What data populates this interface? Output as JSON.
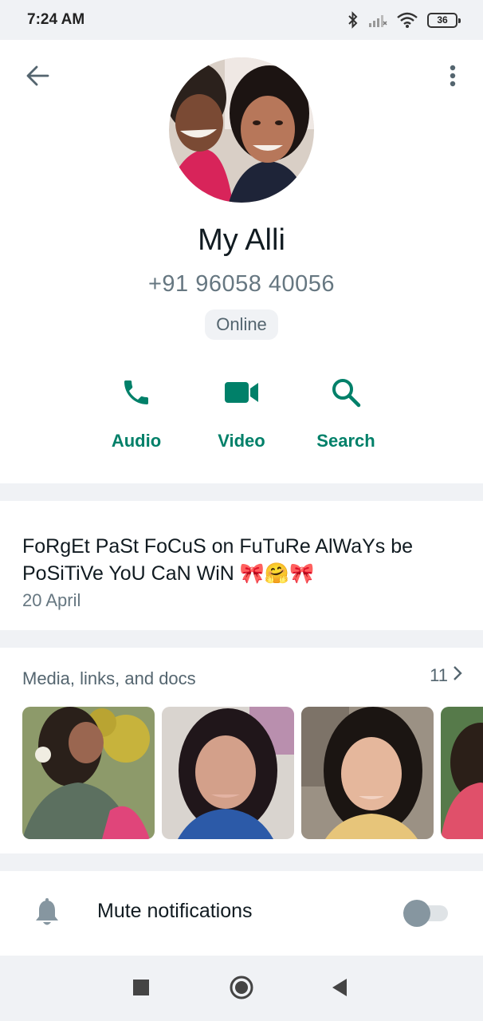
{
  "status_bar": {
    "time": "7:24 AM",
    "battery": "36",
    "icons": [
      "bluetooth-icon",
      "signal-icon",
      "wifi-icon",
      "battery-icon"
    ]
  },
  "header": {
    "back_icon": "arrow-left-icon",
    "menu_icon": "more-vertical-icon"
  },
  "contact": {
    "name": "My Alli",
    "phone": "+91 96058 40056",
    "presence": "Online"
  },
  "actions": [
    {
      "label": "Audio",
      "icon": "phone-icon"
    },
    {
      "label": "Video",
      "icon": "video-icon"
    },
    {
      "label": "Search",
      "icon": "search-icon"
    }
  ],
  "about": {
    "text": "FoRgEt PaSt FoCuS on FuTuRe AlWaYs be PoSiTiVe YoU CaN WiN 🎀🤗🎀",
    "date": "20 April"
  },
  "media": {
    "title": "Media, links, and docs",
    "count": "11"
  },
  "notifications": {
    "mute_label": "Mute notifications",
    "muted": false
  },
  "colors": {
    "accent": "#008069",
    "background": "#f0f2f5",
    "card": "#ffffff",
    "secondary_text": "#667781"
  }
}
